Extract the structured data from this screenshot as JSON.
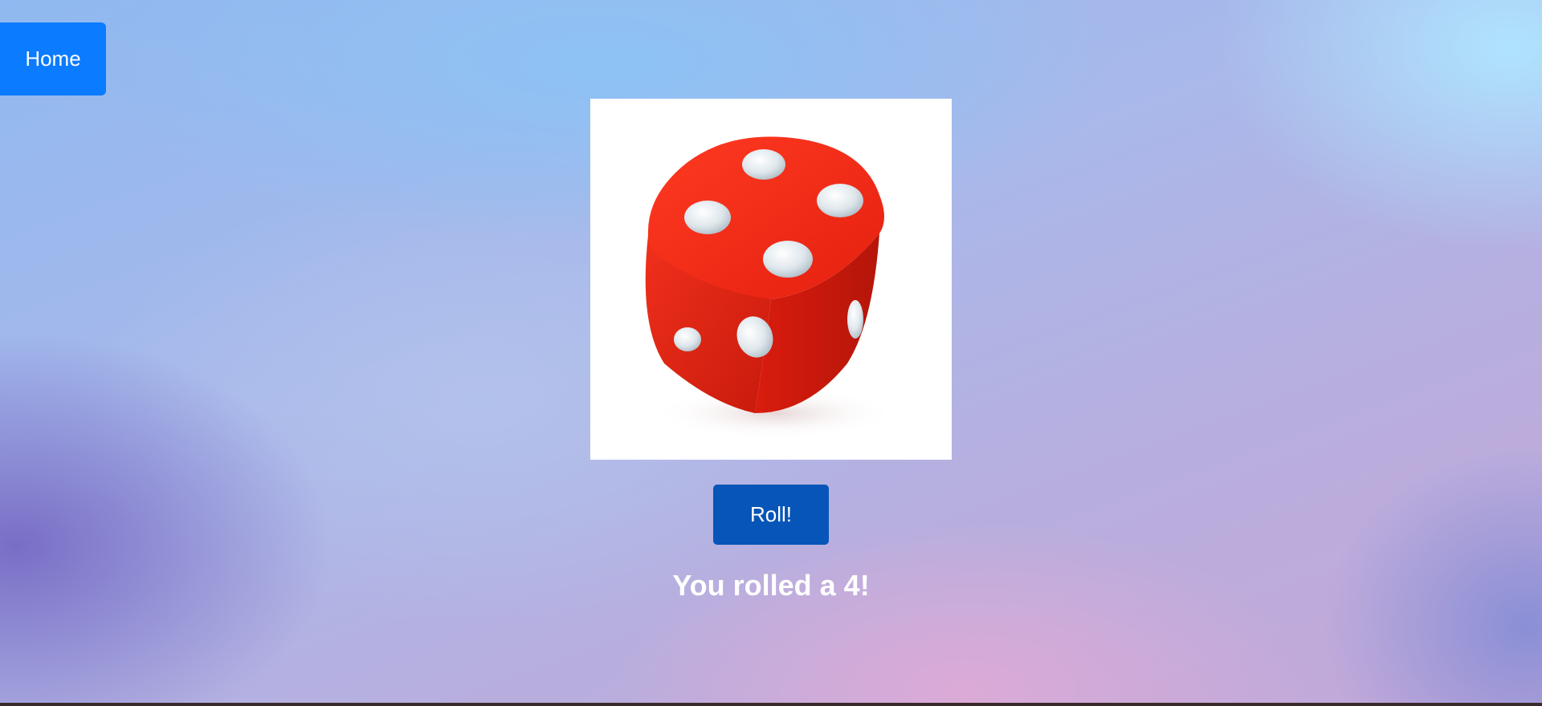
{
  "nav": {
    "home_label": "Home"
  },
  "die": {
    "face_value": 4,
    "icon": "red-die-image"
  },
  "controls": {
    "roll_label": "Roll!"
  },
  "result": {
    "text": "You rolled a 4!"
  },
  "colors": {
    "home_button": "#0b7bff",
    "roll_button": "#0755b8",
    "die_body": "#e8281a",
    "pips": "#dce6ec"
  }
}
